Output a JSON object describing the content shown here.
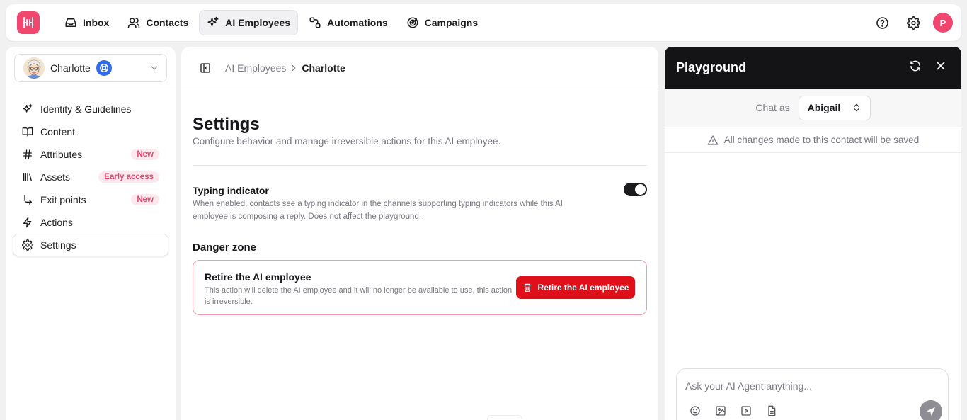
{
  "nav": {
    "items": [
      {
        "label": "Inbox",
        "icon": "inbox-icon"
      },
      {
        "label": "Contacts",
        "icon": "contacts-icon"
      },
      {
        "label": "AI Employees",
        "icon": "sparkles-icon",
        "active": true
      },
      {
        "label": "Automations",
        "icon": "automations-icon"
      },
      {
        "label": "Campaigns",
        "icon": "campaigns-icon"
      }
    ],
    "user_initial": "P"
  },
  "sidebar": {
    "agent_name": "Charlotte",
    "items": [
      {
        "label": "Identity & Guidelines",
        "icon": "sparkles-icon"
      },
      {
        "label": "Content",
        "icon": "book-icon"
      },
      {
        "label": "Attributes",
        "icon": "hash-icon",
        "badge": "New"
      },
      {
        "label": "Assets",
        "icon": "library-icon",
        "badge": "Early access"
      },
      {
        "label": "Exit points",
        "icon": "corner-arrow-icon",
        "badge": "New"
      },
      {
        "label": "Actions",
        "icon": "lightning-icon"
      },
      {
        "label": "Settings",
        "icon": "gear-icon",
        "active": true
      }
    ]
  },
  "main": {
    "breadcrumb": {
      "parent": "AI Employees",
      "current": "Charlotte"
    },
    "title": "Settings",
    "description": "Configure behavior and manage irreversible actions for this AI employee.",
    "typing": {
      "title": "Typing indicator",
      "description": "When enabled, contacts see a typing indicator in the channels supporting typing indicators while this AI employee is composing a reply. Does not affect the playground.",
      "enabled": true
    },
    "danger": {
      "title": "Danger zone",
      "retire_title": "Retire the AI employee",
      "retire_description": "This action will delete the AI employee and it will no longer be available to use, this action is irreversible.",
      "retire_button": "Retire the AI employee"
    }
  },
  "playground": {
    "title": "Playground",
    "chat_as_label": "Chat as",
    "chat_as_value": "Abigail",
    "notice": "All changes made to this contact will be saved",
    "input_placeholder": "Ask your AI Agent anything..."
  },
  "colors": {
    "brand": "#f2466f",
    "danger": "#e0101b",
    "accent_blue": "#2f6bec"
  }
}
